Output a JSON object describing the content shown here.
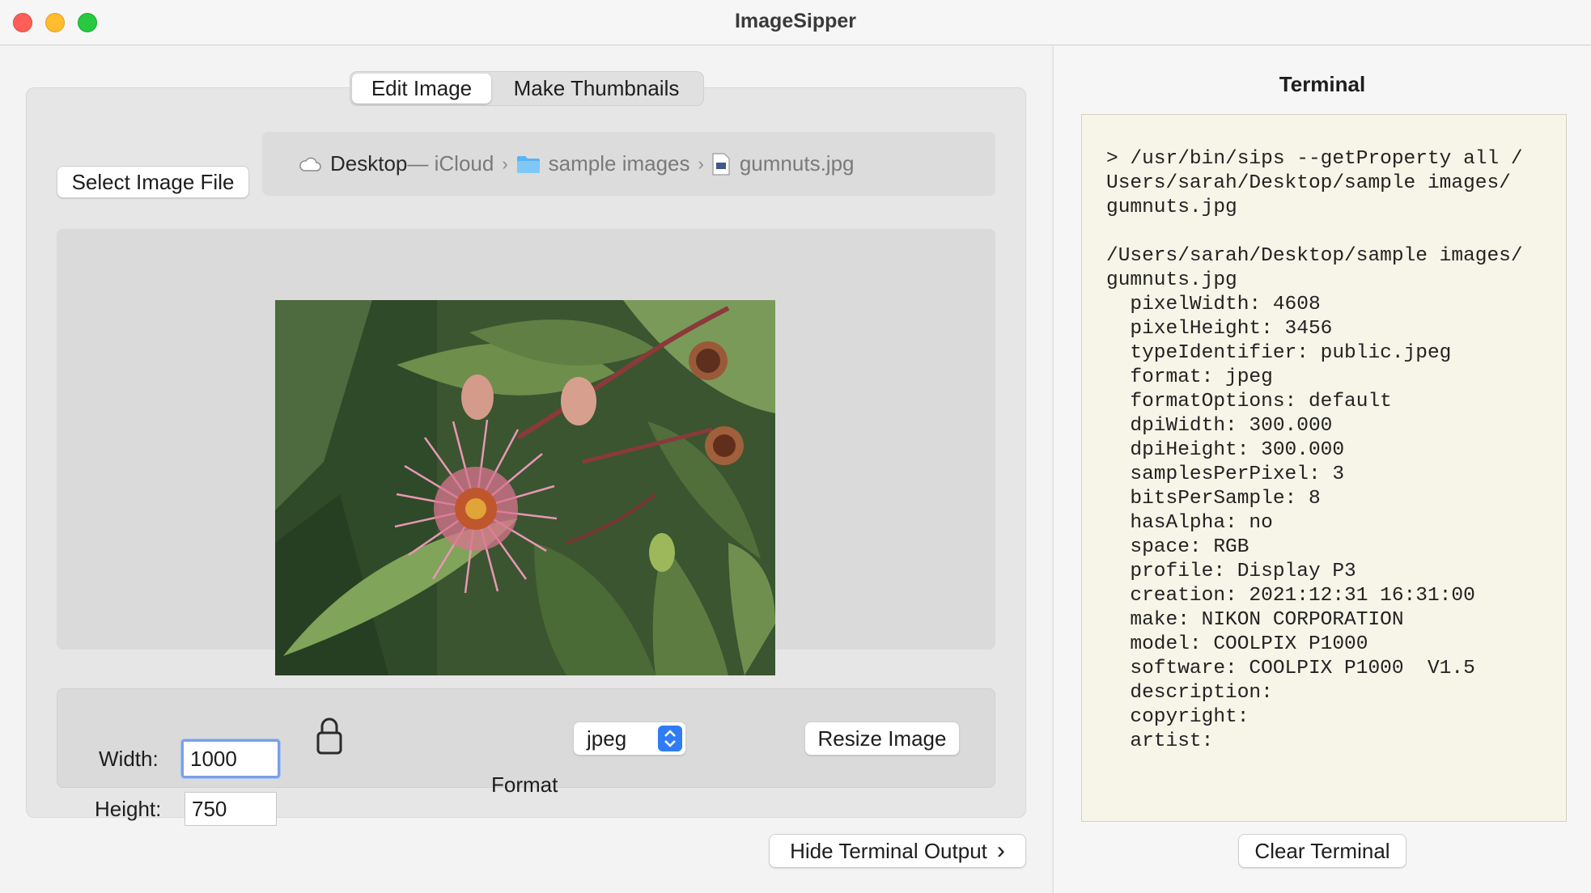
{
  "window": {
    "title": "ImageSipper"
  },
  "tabs": [
    {
      "label": "Edit Image",
      "selected": true
    },
    {
      "label": "Make Thumbnails",
      "selected": false
    }
  ],
  "edit": {
    "select_button": "Select Image File",
    "path": {
      "location": "Desktop",
      "location_suffix": " — iCloud",
      "folder": "sample images",
      "file": "gumnuts.jpg"
    },
    "width_label": "Width:",
    "width_value": "1000",
    "height_label": "Height:",
    "height_value": "750",
    "format_label": "Format",
    "format_value": "jpeg",
    "resize_button": "Resize Image"
  },
  "hide_terminal_button": "Hide Terminal Output",
  "terminal": {
    "title": "Terminal",
    "lines": [
      "> /usr/bin/sips --getProperty all /",
      "Users/sarah/Desktop/sample images/",
      "gumnuts.jpg",
      "",
      "/Users/sarah/Desktop/sample images/",
      "gumnuts.jpg",
      "  pixelWidth: 4608",
      "  pixelHeight: 3456",
      "  typeIdentifier: public.jpeg",
      "  format: jpeg",
      "  formatOptions: default",
      "  dpiWidth: 300.000",
      "  dpiHeight: 300.000",
      "  samplesPerPixel: 3",
      "  bitsPerSample: 8",
      "  hasAlpha: no",
      "  space: RGB",
      "  profile: Display P3",
      "  creation: 2021:12:31 16:31:00",
      "  make: NIKON CORPORATION",
      "  model: COOLPIX P1000",
      "  software: COOLPIX P1000  V1.5",
      "  description:",
      "  copyright:",
      "  artist:"
    ],
    "clear_button": "Clear Terminal"
  },
  "colors": {
    "accent": "#2f7cf6",
    "focus_ring": "#7aa0e6",
    "terminal_bg": "#f7f5e8",
    "traffic_close": "#ff5f57",
    "traffic_minimize": "#febc2e",
    "traffic_zoom": "#28c840"
  },
  "icons": {
    "location": "cloud-icon",
    "folder": "folder-icon",
    "file": "jpeg-file-icon",
    "lock": "lock-icon",
    "disclosure": "chevron-right-icon",
    "select": "up-down-arrows-icon"
  }
}
